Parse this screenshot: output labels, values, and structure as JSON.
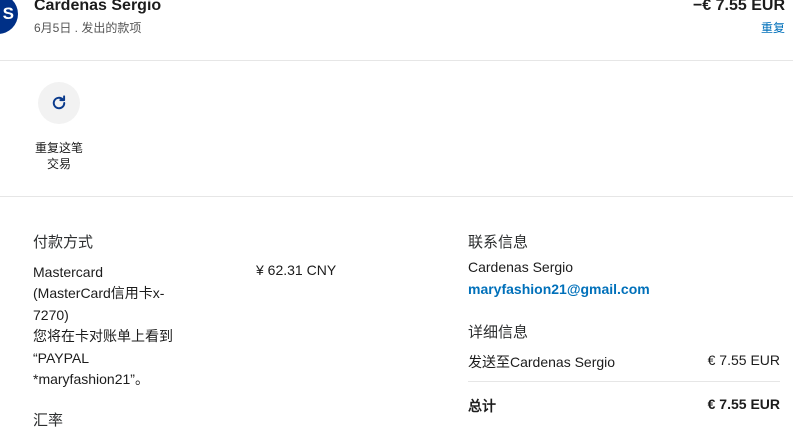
{
  "header": {
    "avatar_initial": "S",
    "merchant": "Cardenas Sergio",
    "subline": "6月5日 . 发出的款项",
    "amount": "−€ 7.55 EUR",
    "repeat_link": "重复"
  },
  "actions": {
    "repeat_icon": "refresh-icon",
    "repeat_label_line1": "重复这笔",
    "repeat_label_line2": "交易"
  },
  "payment": {
    "title": "付款方式",
    "lines": [
      "Mastercard",
      "(MasterCard信用卡x-",
      "7270)",
      "您将在卡对账单上看到",
      "“PAYPAL",
      "*maryfashion21”。"
    ],
    "amount": "¥ 62.31 CNY",
    "exchange_title": "汇率"
  },
  "contact": {
    "title": "联系信息",
    "name": "Cardenas Sergio",
    "email": "maryfashion21@gmail.com"
  },
  "details": {
    "title": "详细信息",
    "send_label": "发送至Cardenas Sergio",
    "send_value": "€ 7.55 EUR",
    "total_label": "总计",
    "total_value": "€ 7.55 EUR"
  },
  "colors": {
    "brand": "#003087",
    "link": "#0070ba"
  }
}
